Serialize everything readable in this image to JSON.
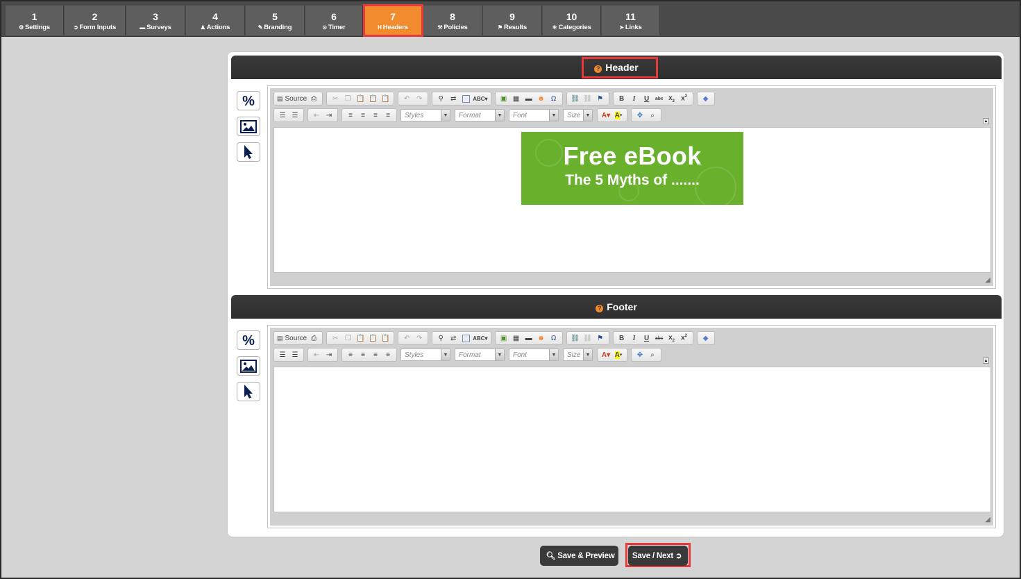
{
  "steps": [
    {
      "num": "1",
      "label": "Settings",
      "icon": "⚙"
    },
    {
      "num": "2",
      "label": "Form Inputs",
      "icon": "➲"
    },
    {
      "num": "3",
      "label": "Surveys",
      "icon": "▬"
    },
    {
      "num": "4",
      "label": "Actions",
      "icon": "♟"
    },
    {
      "num": "5",
      "label": "Branding",
      "icon": "✎"
    },
    {
      "num": "6",
      "label": "Timer",
      "icon": "⊙"
    },
    {
      "num": "7",
      "label": "Headers",
      "icon": "H"
    },
    {
      "num": "8",
      "label": "Policies",
      "icon": "⚒"
    },
    {
      "num": "9",
      "label": "Results",
      "icon": "⚑"
    },
    {
      "num": "10",
      "label": "Categories",
      "icon": "⚛"
    },
    {
      "num": "11",
      "label": "Links",
      "icon": "➤"
    }
  ],
  "active_step": "7",
  "header_section": {
    "title": "Header",
    "help_icon": "?"
  },
  "footer_section": {
    "title": "Footer",
    "help_icon": "?"
  },
  "toolbar": {
    "source_label": "Source",
    "styles_placeholder": "Styles",
    "format_placeholder": "Format",
    "font_placeholder": "Font",
    "size_placeholder": "Size"
  },
  "banner": {
    "line1": "Free eBook",
    "line2": "The 5 Myths of .......",
    "bg_color": "#69b02c"
  },
  "buttons": {
    "save_preview": "Save & Preview",
    "save_next": "Save / Next"
  },
  "colors": {
    "accent": "#f28a2e",
    "highlight": "#e63a3a",
    "navy_icon": "#0a1e52"
  }
}
